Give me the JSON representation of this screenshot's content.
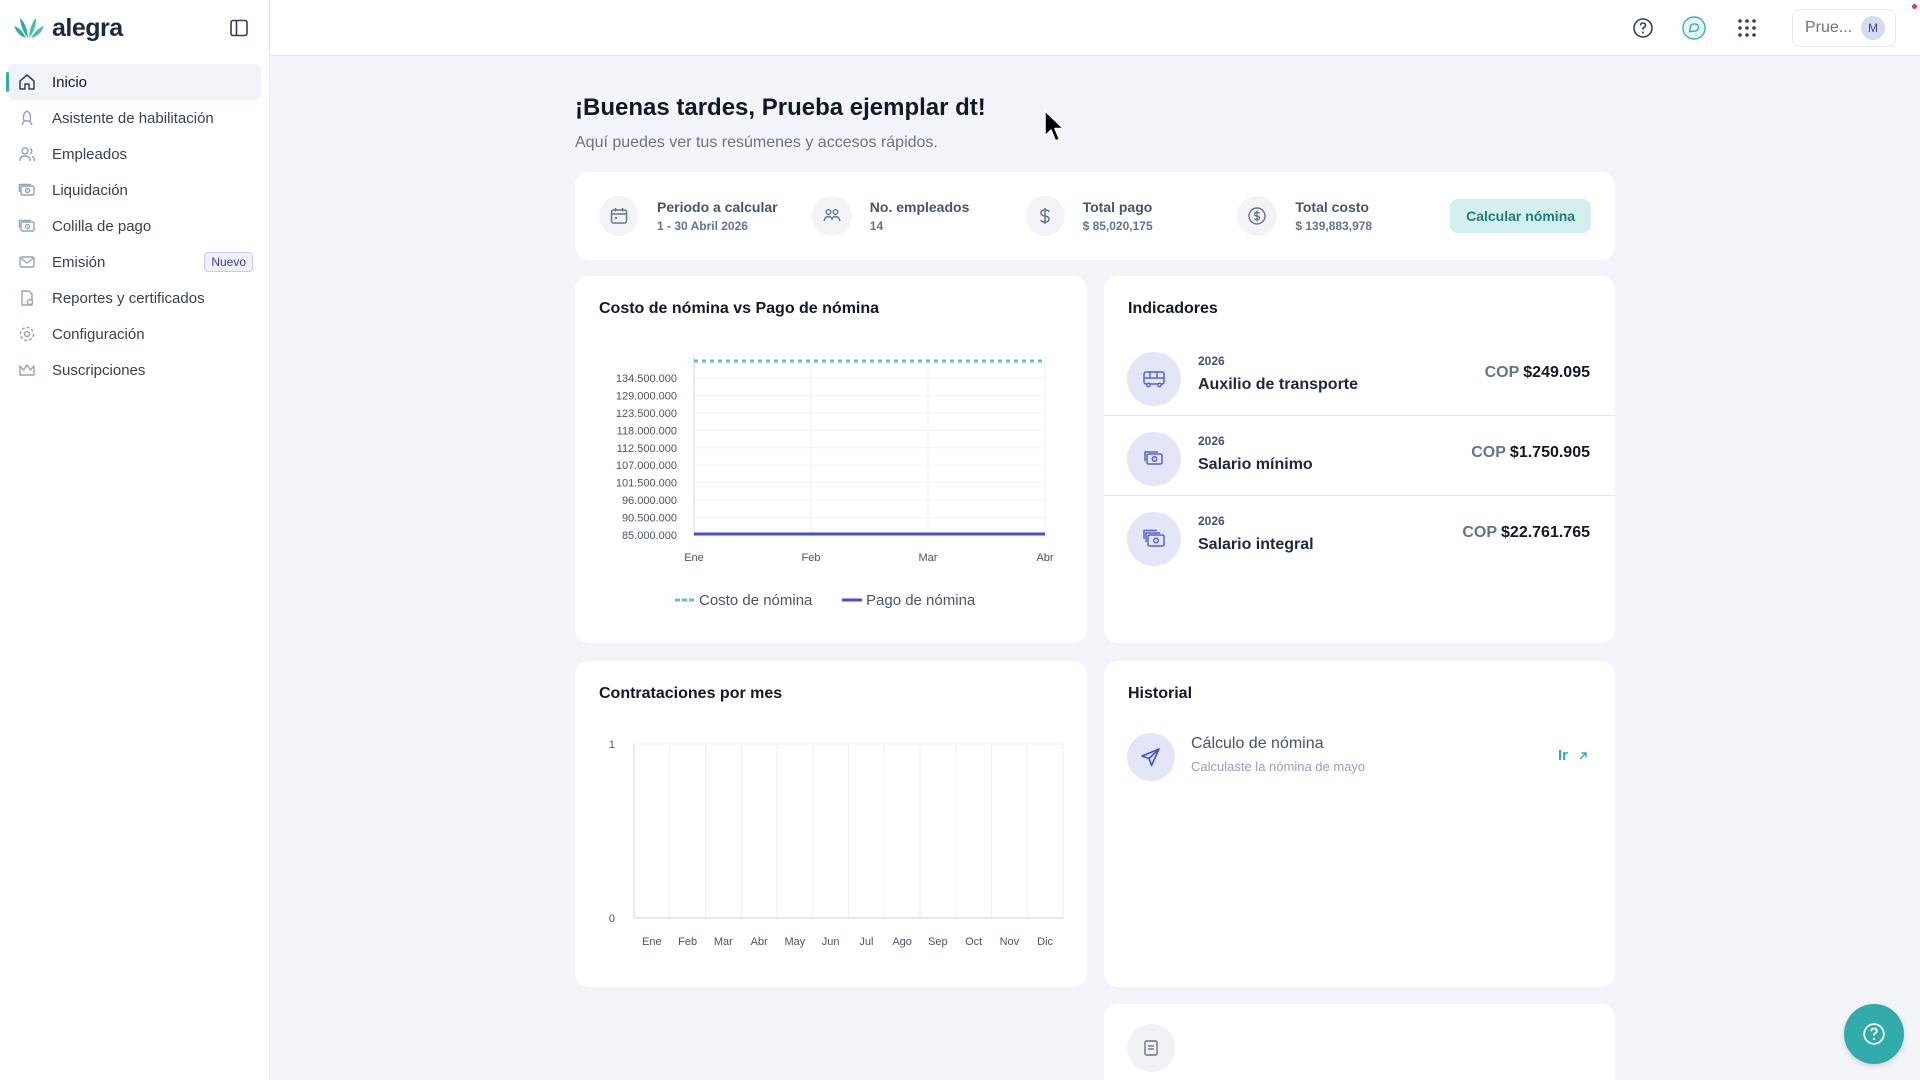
{
  "app": {
    "logo_text": "alegra"
  },
  "sidebar": {
    "items": [
      {
        "label": "Inicio",
        "icon": "home-icon"
      },
      {
        "label": "Asistente de habilitación",
        "icon": "rocket-icon"
      },
      {
        "label": "Empleados",
        "icon": "users-icon"
      },
      {
        "label": "Liquidación",
        "icon": "cash-icon"
      },
      {
        "label": "Colilla de pago",
        "icon": "receipt-icon"
      },
      {
        "label": "Emisión",
        "icon": "mail-icon",
        "badge": "Nuevo"
      },
      {
        "label": "Reportes y certificados",
        "icon": "report-icon"
      },
      {
        "label": "Configuración",
        "icon": "gear-icon"
      },
      {
        "label": "Suscripciones",
        "icon": "crown-icon"
      }
    ]
  },
  "topbar": {
    "user_label": "Prue...",
    "avatar_initial": "M"
  },
  "greeting": {
    "title": "¡Buenas tardes, Prueba ejemplar dt!",
    "subtitle": "Aquí puedes ver tus resúmenes y accesos rápidos."
  },
  "summary": {
    "items": [
      {
        "label": "Periodo a calcular",
        "value": "1 - 30 Abril 2026",
        "icon": "calendar-icon"
      },
      {
        "label": "No. empleados",
        "value": "14",
        "icon": "people-icon"
      },
      {
        "label": "Total pago",
        "value": "$ 85,020,175",
        "icon": "dollar-icon"
      },
      {
        "label": "Total costo",
        "value": "$ 139,883,978",
        "icon": "dollar-circle-icon"
      }
    ],
    "button_label": "Calcular nómina"
  },
  "cost_chart": {
    "title": "Costo de nómina vs Pago de nómina"
  },
  "hiring_chart": {
    "title": "Contrataciones por mes"
  },
  "chart_data": [
    {
      "type": "line",
      "title": "Costo de nómina vs Pago de nómina",
      "categories": [
        "Ene",
        "Feb",
        "Mar",
        "Abr"
      ],
      "y_ticks": [
        "134.500.000",
        "129.000.000",
        "123.500.000",
        "118.000.000",
        "112.500.000",
        "107.000.000",
        "101.500.000",
        "96.000.000",
        "90.500.000",
        "85.000.000"
      ],
      "ylim": [
        85000000,
        139883978
      ],
      "series": [
        {
          "name": "Costo de nómina",
          "values": [
            139883978,
            139883978,
            139883978,
            139883978
          ],
          "color": "#5ec9a4",
          "dashed": true
        },
        {
          "name": "Pago de nómina",
          "values": [
            85020175,
            85020175,
            85020175,
            85020175
          ],
          "color": "#4a4ecb",
          "dashed": false
        }
      ],
      "legend_position": "bottom",
      "grid": true
    },
    {
      "type": "bar",
      "title": "Contrataciones por mes",
      "categories": [
        "Ene",
        "Feb",
        "Mar",
        "Abr",
        "May",
        "Jun",
        "Jul",
        "Ago",
        "Sep",
        "Oct",
        "Nov",
        "Dic"
      ],
      "values": [
        0,
        0,
        0,
        0,
        0,
        0,
        0,
        0,
        0,
        0,
        0,
        0
      ],
      "y_ticks": [
        "1",
        "0"
      ],
      "ylim": [
        0,
        1
      ],
      "grid": true
    }
  ],
  "indicators": {
    "title": "Indicadores",
    "items": [
      {
        "year": "2026",
        "name": "Auxilio de transporte",
        "currency": "COP",
        "value": "$249.095",
        "icon": "bus-icon"
      },
      {
        "year": "2026",
        "name": "Salario mínimo",
        "currency": "COP",
        "value": "$1.750.905",
        "icon": "money-icon"
      },
      {
        "year": "2026",
        "name": "Salario integral",
        "currency": "COP",
        "value": "$22.761.765",
        "icon": "money-stack-icon"
      }
    ]
  },
  "history": {
    "title": "Historial",
    "items": [
      {
        "title": "Cálculo de nómina",
        "subtitle": "Calculaste la nómina de mayo",
        "link_label": "Ir"
      }
    ]
  },
  "colors": {
    "accent": "#30aba9",
    "primary": "#4a4ecb"
  }
}
